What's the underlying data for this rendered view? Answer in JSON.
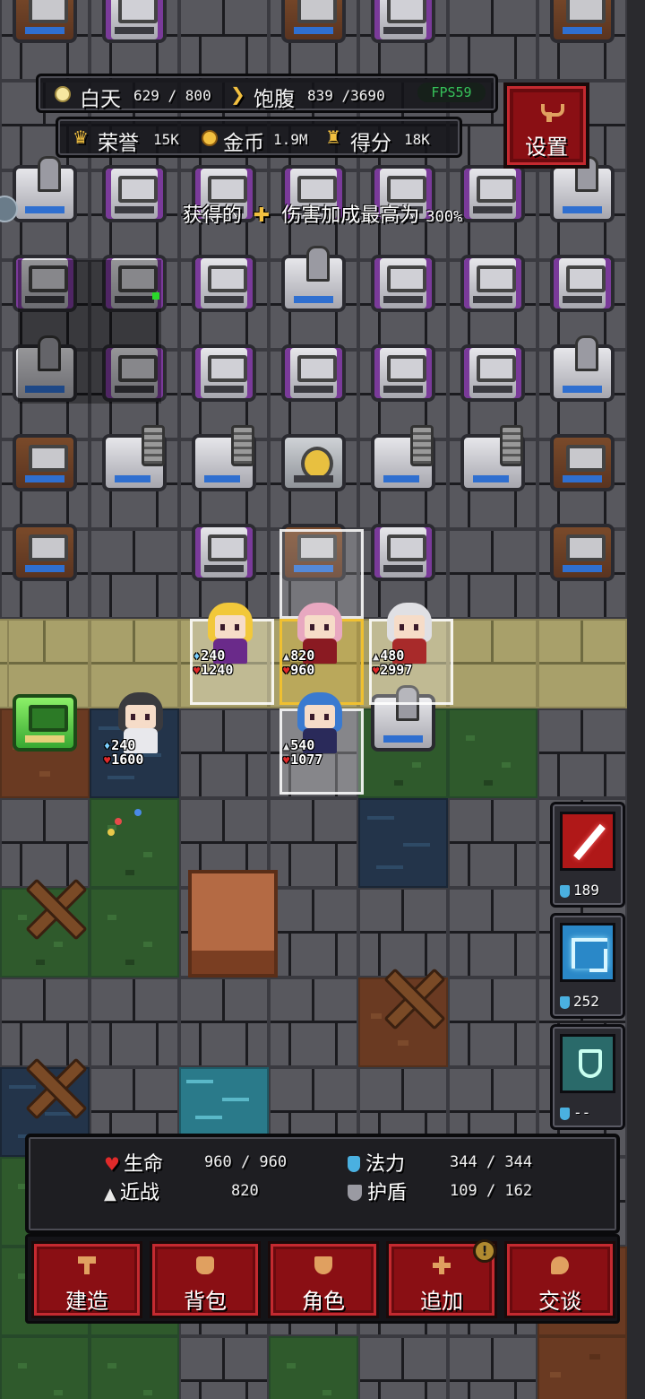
{
  "hud": {
    "day_label": "白天",
    "day_value": "629 / 800",
    "hunger_label": "饱腹",
    "hunger_value": "839 /3690",
    "fps": "FPS59",
    "honor_label": "荣誉",
    "honor_value": "15K",
    "gold_label": "金币",
    "gold_value": "1.9M",
    "score_label": "得分",
    "score_value": "18K",
    "settings_label": "设置"
  },
  "notice": {
    "prefix": "获得的",
    "suffix": "伤害加成最高为",
    "percent": "300%"
  },
  "heroes": [
    {
      "id": "blonde-mage",
      "attack": "240",
      "hp": "1240"
    },
    {
      "id": "pink-warrior",
      "attack": "820",
      "hp": "960"
    },
    {
      "id": "white-knight",
      "attack": "480",
      "hp": "2997"
    },
    {
      "id": "twin-tail-girl",
      "attack": "240",
      "hp": "1600"
    },
    {
      "id": "blue-archer",
      "attack": "540",
      "hp": "1077"
    }
  ],
  "skills": [
    {
      "name": "slash-skill",
      "cost": "189",
      "color": "#b01818"
    },
    {
      "name": "lightning-skill",
      "cost": "252",
      "color": "#2a88c8"
    },
    {
      "name": "shield-skill",
      "cost": "--",
      "color": "#2a6a6a"
    }
  ],
  "stats": {
    "hp_label": "生命",
    "hp_value": "960 / 960",
    "mana_label": "法力",
    "mana_value": "344 / 344",
    "melee_label": "近战",
    "melee_value": "820",
    "shield_label": "护盾",
    "shield_value": "109 / 162"
  },
  "menu": {
    "build": "建造",
    "backpack": "背包",
    "character": "角色",
    "add": "追加",
    "talk": "交谈",
    "alert": "!"
  },
  "colors": {
    "accent_red": "#8a0f14",
    "fps_green": "#36c25a",
    "gold": "#f2c040",
    "mana_blue": "#4ab0e0"
  }
}
